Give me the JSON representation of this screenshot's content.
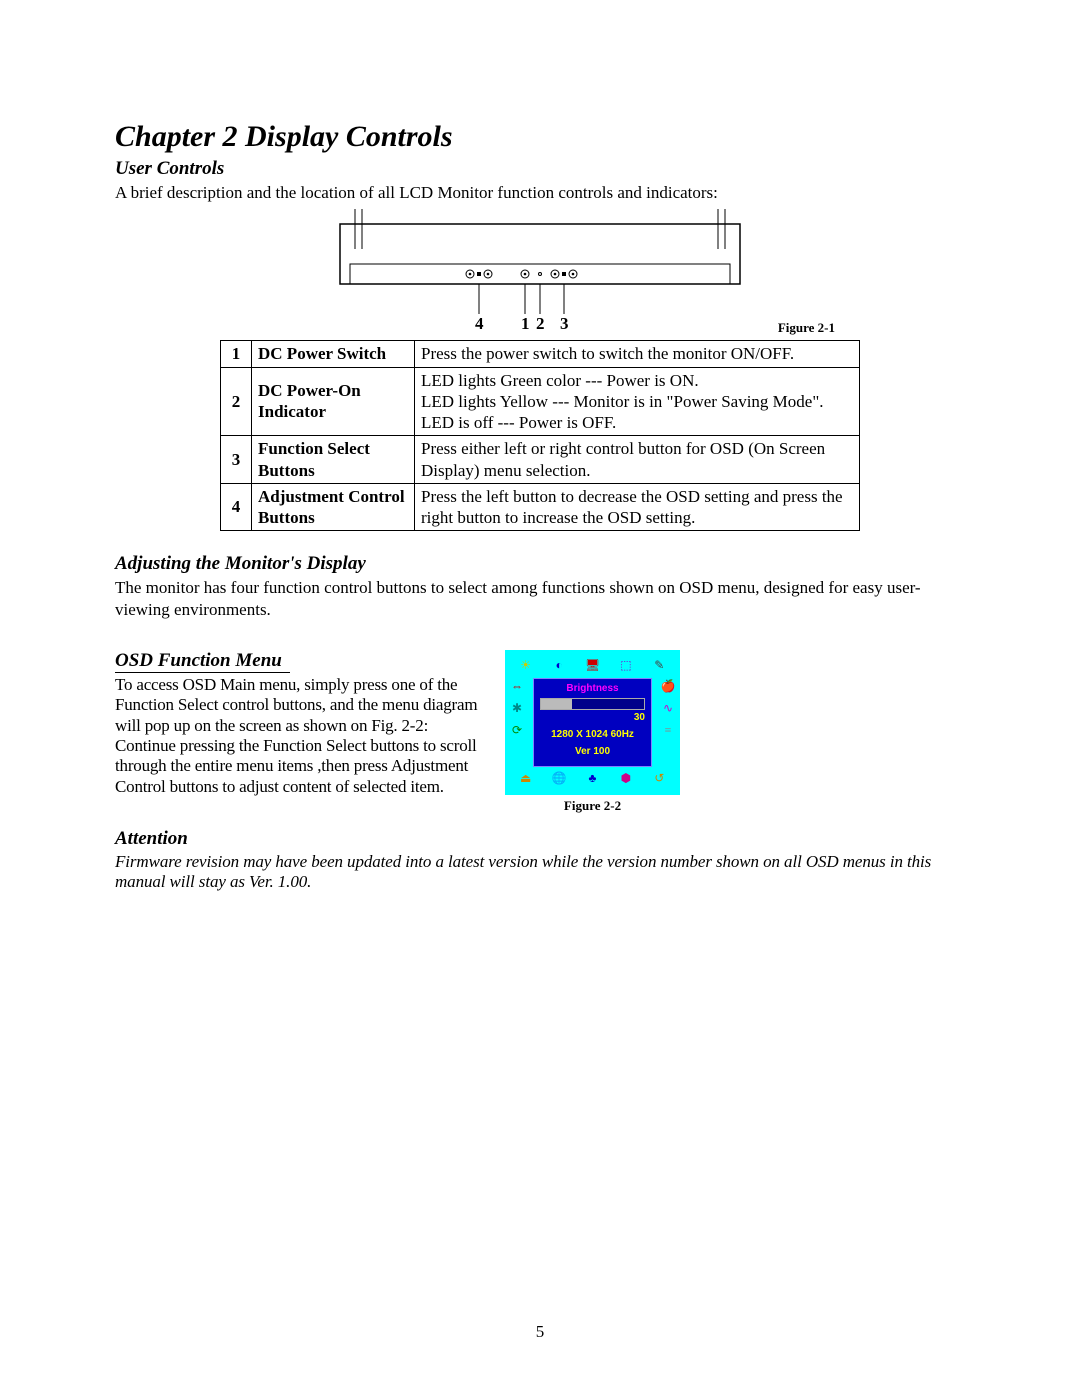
{
  "chapter_title": "Chapter 2 Display Controls",
  "sections": {
    "user_controls": {
      "heading": "User Controls",
      "intro": "A brief description and the location of all LCD Monitor function controls and indicators:"
    },
    "adjusting": {
      "heading": "Adjusting the Monitor's Display",
      "body": "The monitor has four function control buttons to select among functions shown on OSD menu, designed for easy user-viewing environments."
    },
    "osd_menu": {
      "heading": "OSD Function Menu",
      "body": "To access OSD Main menu, simply press one of the Function Select control buttons, and the menu diagram will pop up on the screen as shown on Fig. 2-2: Continue pressing the Function Select buttons to scroll through the entire menu items ,then press Adjustment Control buttons to adjust content of selected item."
    },
    "attention": {
      "heading": "Attention",
      "body": "Firmware revision may have been updated into a latest version while the version number shown on all OSD menus in this manual will stay as Ver. 1.00."
    }
  },
  "figure1": {
    "caption": "Figure 2-1",
    "callouts": [
      "4",
      "1",
      "2",
      "3"
    ]
  },
  "controls_table": [
    {
      "num": "1",
      "name": "DC Power Switch",
      "desc": "Press the power switch to switch the monitor ON/OFF."
    },
    {
      "num": "2",
      "name": "DC Power-On Indicator",
      "desc": "LED lights Green color --- Power is ON.\nLED lights Yellow --- Monitor is in \"Power Saving Mode\".\nLED is off --- Power is OFF."
    },
    {
      "num": "3",
      "name": "Function Select Buttons",
      "desc": "Press either left or right control button for OSD (On Screen Display) menu selection."
    },
    {
      "num": "4",
      "name": "Adjustment Control Buttons",
      "desc": "Press the left button to decrease the OSD setting and press the right button to increase the OSD setting."
    }
  ],
  "osd_screenshot": {
    "label": "Brightness",
    "value": "30",
    "resolution": "1280 X 1024   60Hz",
    "version": "Ver  100",
    "caption": "Figure 2-2"
  },
  "page_number": "5"
}
